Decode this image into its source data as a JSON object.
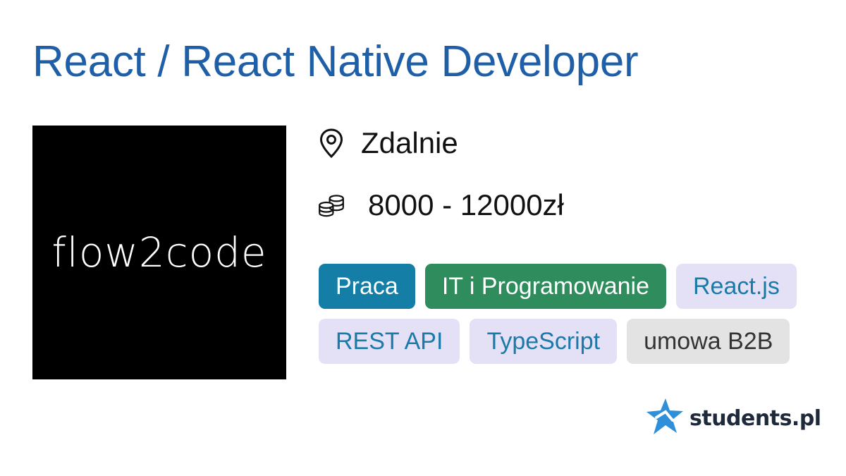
{
  "job": {
    "title": "React / React Native Developer",
    "location": "Zdalnie",
    "salary": "8000 - 12000zł"
  },
  "company": {
    "logo_text": "flow2code"
  },
  "icons": {
    "location": "map-pin-icon",
    "salary": "coins-stack-icon"
  },
  "tags": [
    {
      "label": "Praca",
      "style": "blue"
    },
    {
      "label": "IT i Programowanie",
      "style": "green"
    },
    {
      "label": "React.js",
      "style": "lavender"
    },
    {
      "label": "REST API",
      "style": "lavender"
    },
    {
      "label": "TypeScript",
      "style": "lavender"
    },
    {
      "label": "umowa B2B",
      "style": "grey"
    }
  ],
  "brand": {
    "name": "students.pl"
  },
  "colors": {
    "title": "#1f5fa8",
    "tag_blue": "#157ea6",
    "tag_green": "#2f8c5c",
    "tag_lavender_bg": "#e4e1f6",
    "tag_lavender_text": "#1a7aa8",
    "tag_grey": "#e3e3e3",
    "brand_star": "#2f8fd8"
  }
}
